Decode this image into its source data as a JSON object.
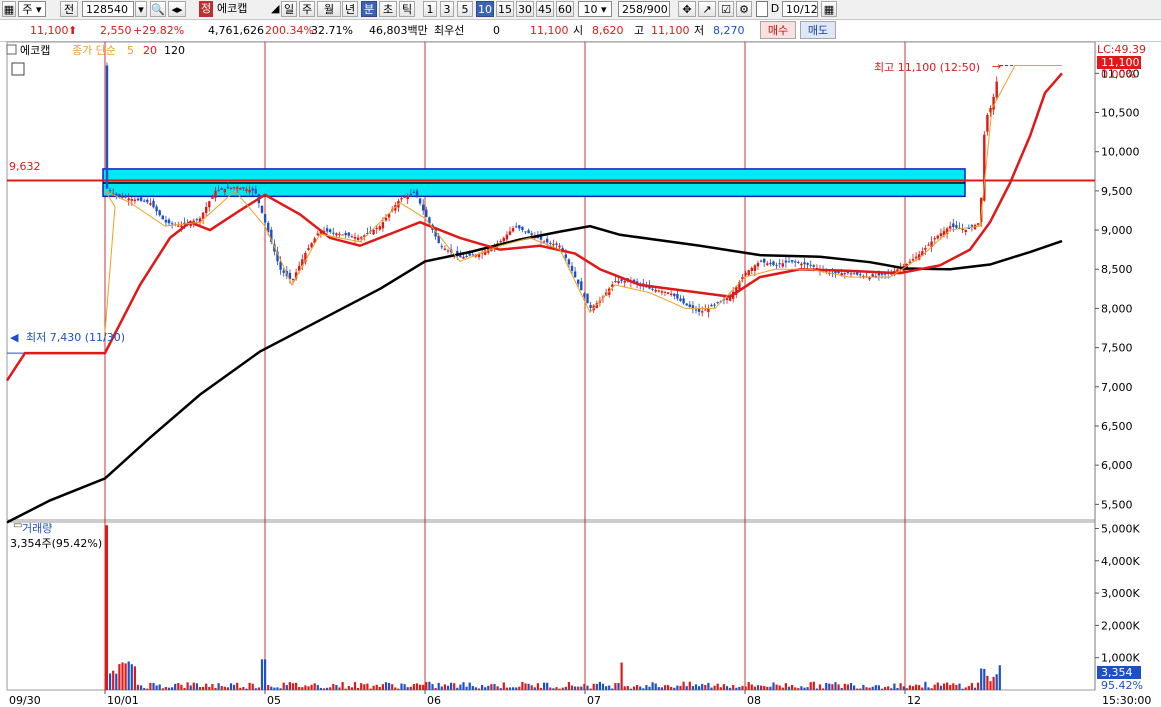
{
  "toolbar": {
    "mode": "주",
    "prev": "전",
    "code": "128540",
    "badge": "정",
    "name": "에코캡",
    "periods": [
      "일",
      "주",
      "월",
      "년",
      "분",
      "초",
      "틱"
    ],
    "intervals": [
      "1",
      "3",
      "5",
      "10",
      "15",
      "30",
      "45",
      "60"
    ],
    "interval_value": "10",
    "count": "258/900",
    "date_check": "D",
    "date": "10/12"
  },
  "info": {
    "price": "11,100",
    "change": "2,550",
    "change_pct": "+29.82%",
    "volume": "4,761,626",
    "vol_ratio": "200.34%",
    "turnover": "32.71%",
    "amount": "46,803백만",
    "priority_label": "최우선",
    "priority_val": "0",
    "ask": "11,100",
    "open_label": "시",
    "open": "8,620",
    "high_label": "고",
    "high": "11,100",
    "low_label": "저",
    "low": "8,270",
    "buy": "매수",
    "sell": "매도"
  },
  "legend": {
    "name": "에코캡",
    "ma_label": "종가 단순",
    "ma5": "5",
    "ma20": "20",
    "ma120": "120",
    "volume_title": "거래량",
    "volume_value": "3,354주(95.42%)"
  },
  "annotations": {
    "high": "최고 11,100 (12:50)",
    "low": "최저 7,430 (11/30)",
    "level": "9,632",
    "lc": "LC:49.39",
    "price_tag": "11,100",
    "pct_tag": "0.00%",
    "vol_tag": "3,354",
    "vol_pct_tag": "95.42%"
  },
  "colors": {
    "up": "#e01818",
    "down": "#1c4fc8",
    "ma5": "#f0a020",
    "ma20": "#e01818",
    "ma120": "#000000",
    "box": "#00e8f0",
    "divider": "#c00000"
  },
  "chart_data": {
    "type": "candlestick",
    "y_ticks": [
      "11,000",
      "10,500",
      "10,000",
      "9,500",
      "9,000",
      "8,500",
      "8,000",
      "7,500",
      "7,000",
      "6,500",
      "6,000",
      "5,500"
    ],
    "vol_ticks": [
      "5,000K",
      "4,000K",
      "3,000K",
      "2,000K",
      "1,000K"
    ],
    "x_labels": [
      "09/30",
      "10/01",
      "05",
      "06",
      "07",
      "08",
      "12",
      "15:30:00"
    ],
    "ylim": [
      5300,
      11400
    ],
    "vol_ylim": [
      0,
      5200
    ],
    "resistance_level": 9632,
    "box_range": [
      9430,
      9780
    ],
    "ohlc_sample": {
      "first_session": {
        "low": 7430,
        "high": 9650
      },
      "last_session": {
        "open": 8620,
        "high": 11100,
        "low": 8270,
        "close": 11100
      }
    }
  }
}
